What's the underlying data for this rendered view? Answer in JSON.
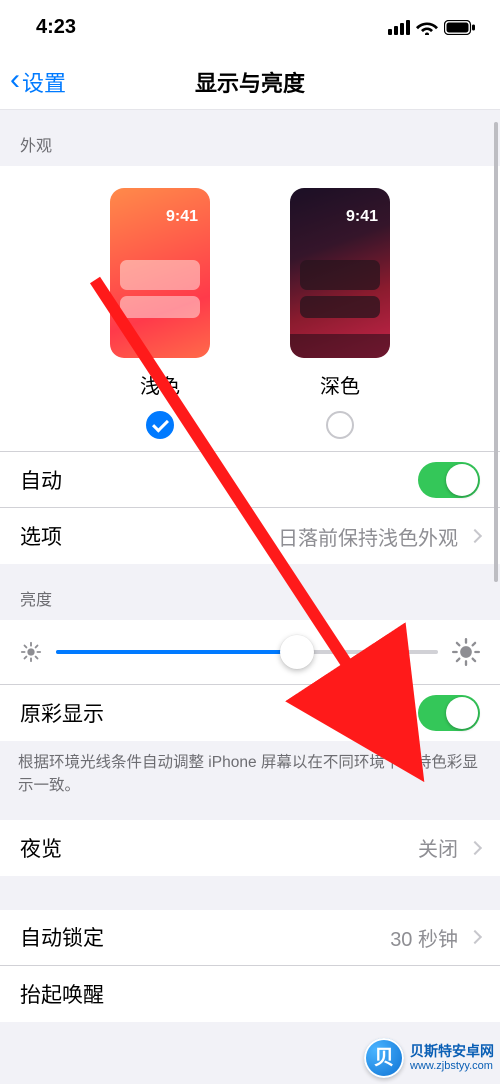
{
  "status": {
    "time": "4:23"
  },
  "nav": {
    "back_label": "设置",
    "title": "显示与亮度"
  },
  "appearance": {
    "section": "外观",
    "preview_time": "9:41",
    "light_label": "浅色",
    "dark_label": "深色",
    "selected": "light",
    "auto_label": "自动",
    "auto_on": true,
    "options_label": "选项",
    "options_value": "日落前保持浅色外观"
  },
  "brightness": {
    "section": "亮度",
    "value_percent": 63,
    "truetone_label": "原彩显示",
    "truetone_on": true,
    "truetone_footer": "根据环境光线条件自动调整 iPhone 屏幕以在不同环境下保持色彩显示一致。"
  },
  "night_shift": {
    "label": "夜览",
    "value": "关闭"
  },
  "autolock": {
    "label": "自动锁定",
    "value": "30 秒钟"
  },
  "raise": {
    "label": "抬起唤醒"
  },
  "watermark": {
    "name": "贝斯特安卓网",
    "url": "www.zjbstyy.com"
  }
}
